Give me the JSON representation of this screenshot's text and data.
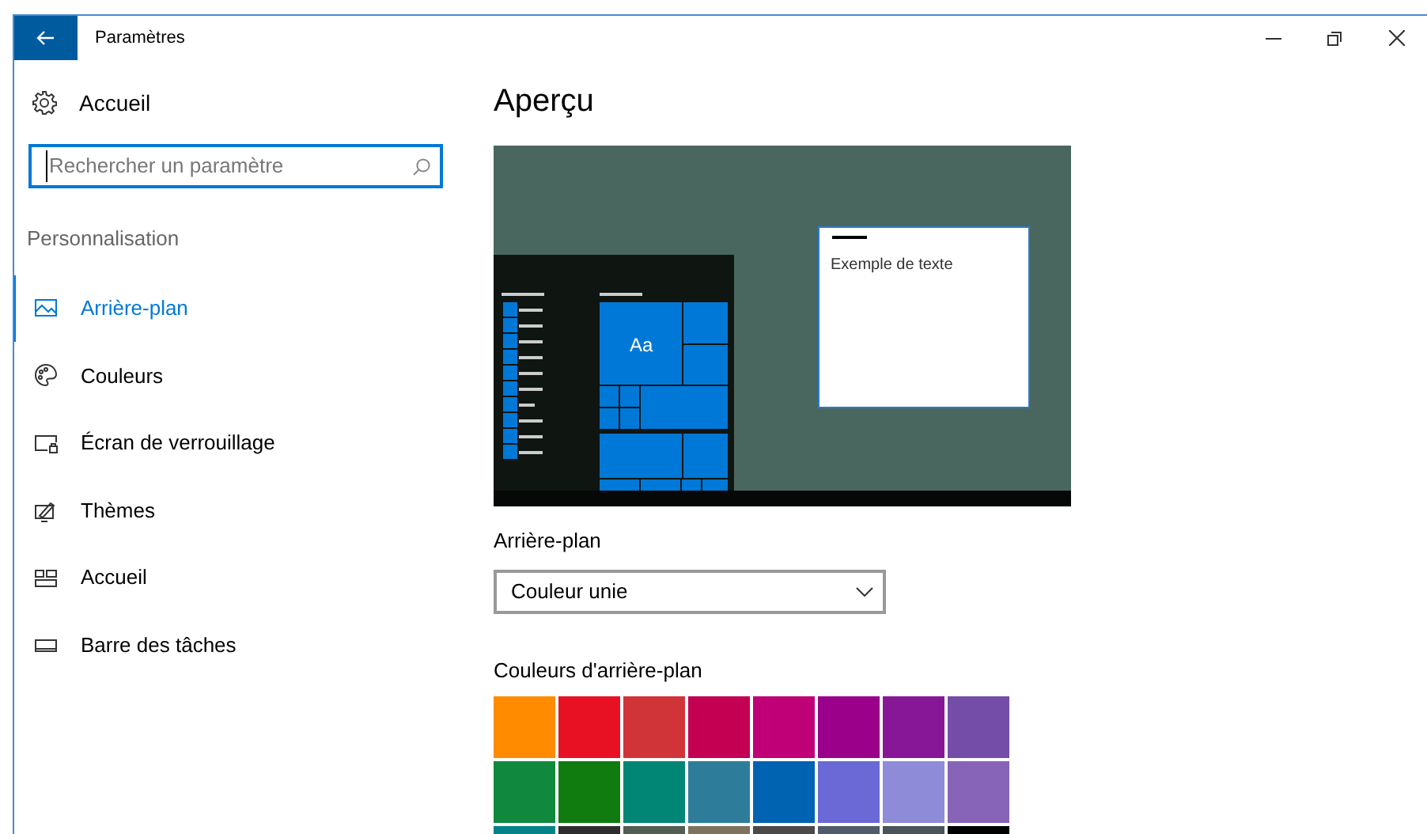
{
  "window": {
    "title": "Paramètres"
  },
  "sidebar": {
    "home": "Accueil",
    "search": {
      "placeholder": "Rechercher un paramètre"
    },
    "section": "Personnalisation",
    "items": [
      {
        "label": "Arrière-plan",
        "selected": true
      },
      {
        "label": "Couleurs",
        "selected": false
      },
      {
        "label": "Écran de verrouillage",
        "selected": false
      },
      {
        "label": "Thèmes",
        "selected": false
      },
      {
        "label": "Accueil",
        "selected": false
      },
      {
        "label": "Barre des tâches",
        "selected": false
      }
    ]
  },
  "main": {
    "title": "Aperçu",
    "preview": {
      "tile_label": "Aa",
      "window_text": "Exemple de texte"
    },
    "background": {
      "label": "Arrière-plan",
      "value": "Couleur unie"
    },
    "colors": {
      "label": "Couleurs d'arrière-plan",
      "swatches": [
        {
          "color": "#ff8c00"
        },
        {
          "color": "#e81123"
        },
        {
          "color": "#d13438"
        },
        {
          "color": "#c30052"
        },
        {
          "color": "#bf0077"
        },
        {
          "color": "#9a0089"
        },
        {
          "color": "#881798"
        },
        {
          "color": "#744da9"
        },
        {
          "color": "#10893e"
        },
        {
          "color": "#107c10"
        },
        {
          "color": "#018574"
        },
        {
          "color": "#2d7d9a"
        },
        {
          "color": "#0063b1"
        },
        {
          "color": "#6b69d6"
        },
        {
          "color": "#8e8cd8"
        },
        {
          "color": "#8764b8"
        },
        {
          "color": "#038387"
        },
        {
          "color": "#2d2d2d"
        },
        {
          "color": "#525e54"
        },
        {
          "color": "#7e735f"
        },
        {
          "color": "#4c4a48"
        },
        {
          "color": "#515c6b"
        },
        {
          "color": "#4a5459"
        },
        {
          "color": "#000000"
        }
      ]
    }
  }
}
